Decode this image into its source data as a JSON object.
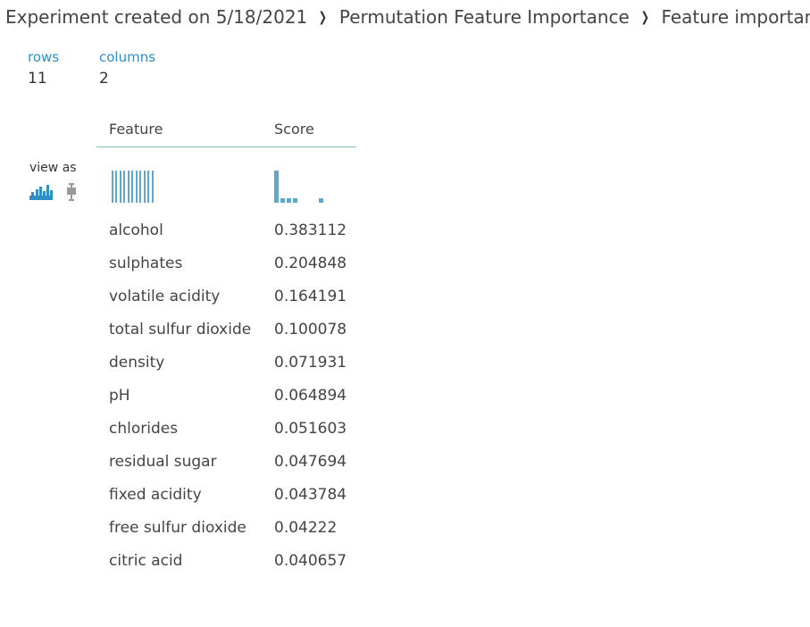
{
  "breadcrumb": {
    "items": [
      {
        "label": "Experiment created on 5/18/2021"
      },
      {
        "label": "Permutation Feature Importance"
      },
      {
        "label": "Feature importance"
      }
    ],
    "separator": "❯"
  },
  "stats": {
    "rows": {
      "label": "rows",
      "value": "11"
    },
    "columns": {
      "label": "columns",
      "value": "2"
    }
  },
  "view_as": {
    "label": "view as",
    "options": [
      {
        "icon": "histogram-icon",
        "selected": true
      },
      {
        "icon": "boxplot-icon",
        "selected": false
      }
    ]
  },
  "table": {
    "columns": [
      {
        "label": "Feature"
      },
      {
        "label": "Score"
      }
    ],
    "rows": [
      {
        "feature": "alcohol",
        "score": "0.383112"
      },
      {
        "feature": "sulphates",
        "score": "0.204848"
      },
      {
        "feature": "volatile acidity",
        "score": "0.164191"
      },
      {
        "feature": "total sulfur dioxide",
        "score": "0.100078"
      },
      {
        "feature": "density",
        "score": "0.071931"
      },
      {
        "feature": "pH",
        "score": "0.064894"
      },
      {
        "feature": "chlorides",
        "score": "0.051603"
      },
      {
        "feature": "residual sugar",
        "score": "0.047694"
      },
      {
        "feature": "fixed acidity",
        "score": "0.043784"
      },
      {
        "feature": "free sulfur dioxide",
        "score": "0.04222"
      },
      {
        "feature": "citric acid",
        "score": "0.040657"
      }
    ]
  },
  "colors": {
    "accent": "#2f8fc7",
    "sparkline": "#5aa9cf",
    "header_rule": "#7fbcc4",
    "icon_inactive": "#999999"
  }
}
